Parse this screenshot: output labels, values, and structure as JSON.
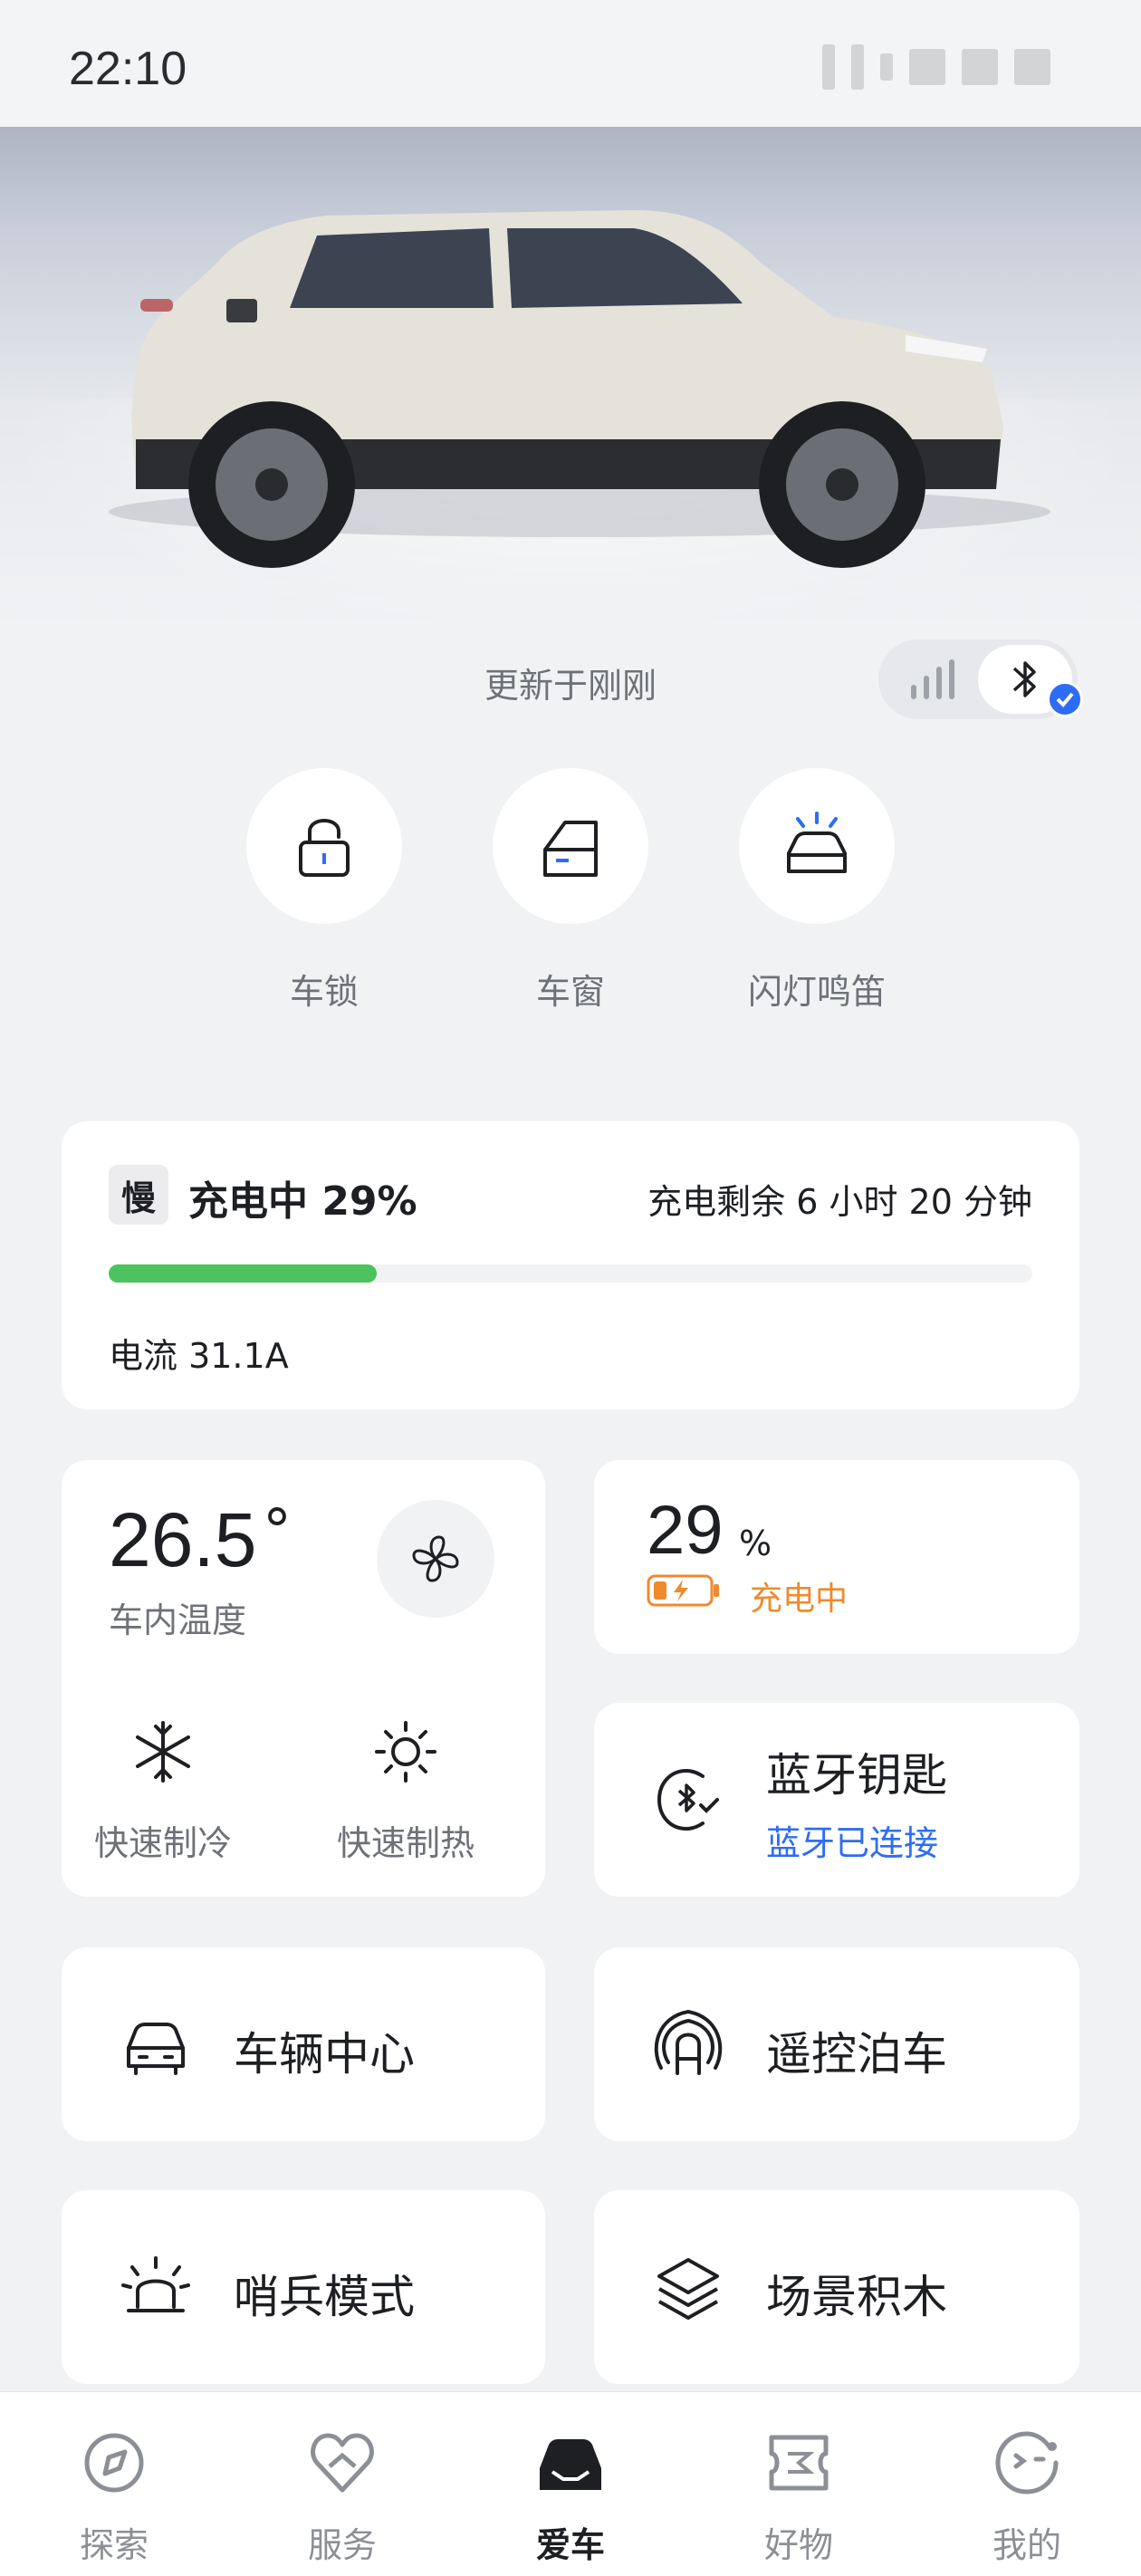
{
  "status_bar": {
    "time": "22:10"
  },
  "vehicle": {
    "update_text": "更新于刚刚",
    "connection": {
      "signal_icon": "signal-bars-icon",
      "bluetooth_icon": "bluetooth-icon",
      "bluetooth_active": true
    }
  },
  "quick_actions": [
    {
      "label": "车锁",
      "icon": "lock-icon"
    },
    {
      "label": "车窗",
      "icon": "car-window-icon"
    },
    {
      "label": "闪灯鸣笛",
      "icon": "car-flash-horn-icon"
    }
  ],
  "charging": {
    "badge": "慢",
    "title": "充电中 29%",
    "remaining": "充电剩余 6 小时 20 分钟",
    "progress": 0.29,
    "current": "电流 31.1A",
    "progress_color": "#4cc35f"
  },
  "climate": {
    "temperature": "26.5",
    "degree_symbol": "°",
    "label": "车内温度",
    "fan_icon": "fan-icon",
    "modes": [
      {
        "label": "快速制冷",
        "icon": "snowflake-icon"
      },
      {
        "label": "快速制热",
        "icon": "sun-icon"
      }
    ]
  },
  "battery": {
    "value": "29",
    "unit": "%",
    "status": "充电中",
    "status_color": "#f08a2c"
  },
  "bluetooth_key": {
    "title": "蓝牙钥匙",
    "status": "蓝牙已连接",
    "icon": "bluetooth-key-icon",
    "status_color": "#2d6cf6"
  },
  "tiles": [
    {
      "title": "车辆中心",
      "icon": "car-front-icon"
    },
    {
      "title": "遥控泊车",
      "icon": "remote-parking-icon"
    },
    {
      "title": "哨兵模式",
      "icon": "sentry-alarm-icon"
    },
    {
      "title": "场景积木",
      "icon": "layers-icon"
    }
  ],
  "tab_bar": [
    {
      "label": "探索",
      "icon": "explore-icon",
      "active": false
    },
    {
      "label": "服务",
      "icon": "service-heart-icon",
      "active": false
    },
    {
      "label": "爱车",
      "icon": "car-icon",
      "active": true
    },
    {
      "label": "好物",
      "icon": "ticket-icon",
      "active": false
    },
    {
      "label": "我的",
      "icon": "profile-face-icon",
      "active": false
    }
  ]
}
